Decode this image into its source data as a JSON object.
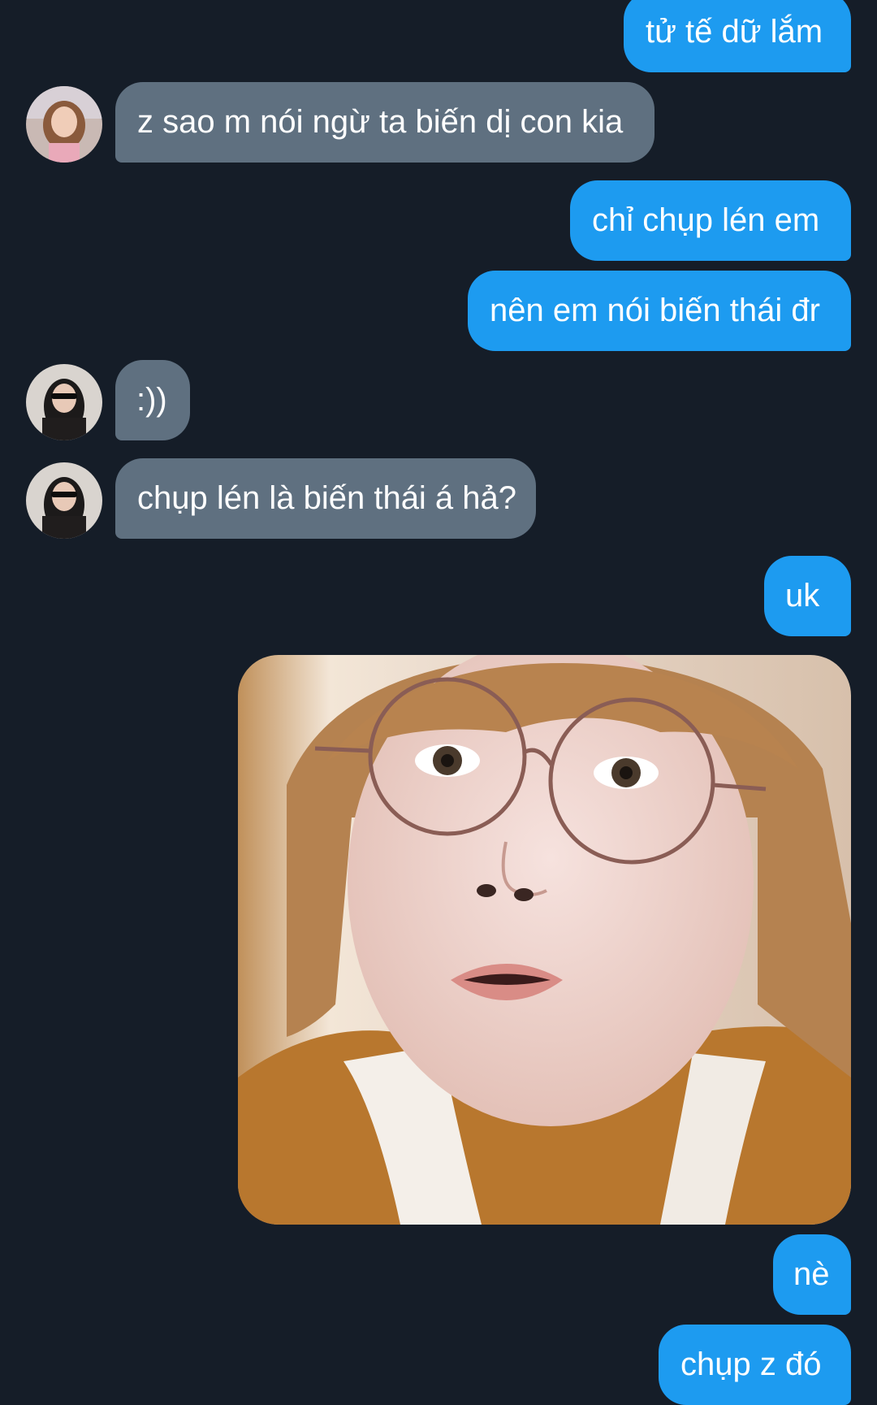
{
  "conversation": {
    "messages": [
      {
        "from": "me",
        "text": "tử tế dữ lắm"
      },
      {
        "from": "them",
        "text": "z sao m nói ngừ ta biến dị con kia"
      },
      {
        "from": "me",
        "text": "chỉ chụp lén em"
      },
      {
        "from": "me",
        "text": "nên em nói biến thái đr"
      },
      {
        "from": "them",
        "text": ":))"
      },
      {
        "from": "them",
        "text": "chụp lén là biến thái á hả?"
      },
      {
        "from": "me",
        "text": "uk"
      },
      {
        "from": "me",
        "image": "photo-of-person-with-round-glasses"
      },
      {
        "from": "me",
        "text": "nè"
      },
      {
        "from": "me",
        "text": "chụp z đó"
      }
    ]
  },
  "colors": {
    "background": "#151d28",
    "outgoing_bubble": "#1d9bf0",
    "incoming_bubble": "#5f7080",
    "text": "#ffffff"
  }
}
